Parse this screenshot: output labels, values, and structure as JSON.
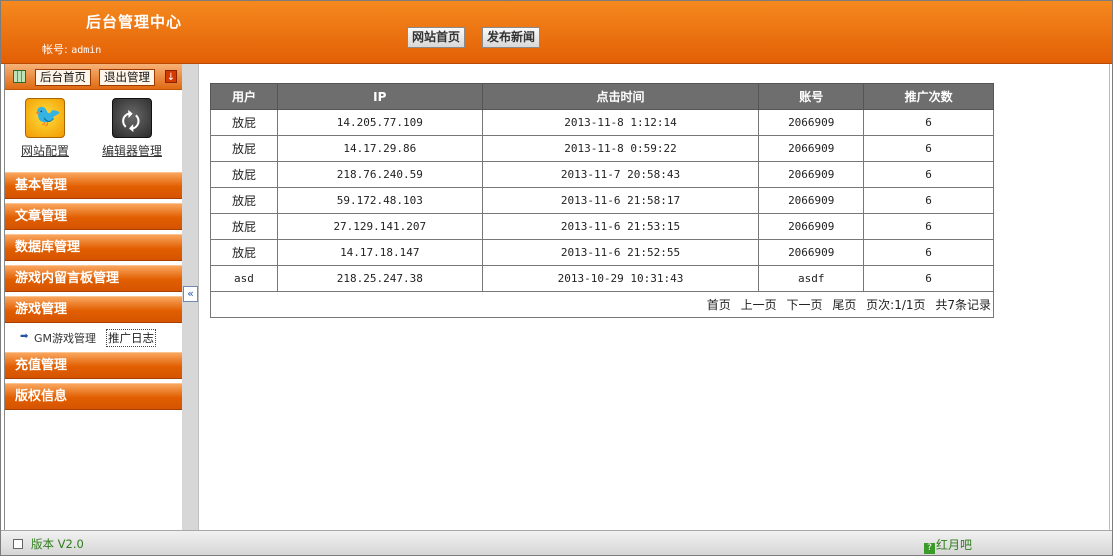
{
  "header": {
    "brand_text": "",
    "title": "后台管理中心",
    "account_label": "帐号:",
    "account_value": "admin",
    "nav_home": "网站首页",
    "nav_news": "发布新闻"
  },
  "sidebar": {
    "top_home": "后台首页",
    "top_exit": "退出管理",
    "shortcut_site_config": "网站配置",
    "shortcut_editor": "编辑器管理",
    "menu": [
      "基本管理",
      "文章管理",
      "数据库管理",
      "游戏内留言板管理",
      "游戏管理",
      "充值管理",
      "版权信息"
    ],
    "submenu": {
      "gm": "GM游戏管理",
      "promo_log": "推广日志"
    },
    "collapse_glyph": "«"
  },
  "table": {
    "headers": [
      "用户",
      "IP",
      "点击时间",
      "账号",
      "推广次数"
    ],
    "rows": [
      [
        "放屁",
        "14.205.77.109",
        "2013-11-8 1:12:14",
        "2066909",
        "6"
      ],
      [
        "放屁",
        "14.17.29.86",
        "2013-11-8 0:59:22",
        "2066909",
        "6"
      ],
      [
        "放屁",
        "218.76.240.59",
        "2013-11-7 20:58:43",
        "2066909",
        "6"
      ],
      [
        "放屁",
        "59.172.48.103",
        "2013-11-6 21:58:17",
        "2066909",
        "6"
      ],
      [
        "放屁",
        "27.129.141.207",
        "2013-11-6 21:53:15",
        "2066909",
        "6"
      ],
      [
        "放屁",
        "14.17.18.147",
        "2013-11-6 21:52:55",
        "2066909",
        "6"
      ],
      [
        "asd",
        "218.25.247.38",
        "2013-10-29 10:31:43",
        "asdf",
        "6"
      ]
    ],
    "pager": {
      "first": "首页",
      "prev": "上一页",
      "next": "下一页",
      "last": "尾页",
      "page_info": "页次:1/1页",
      "total": "共7条记录"
    }
  },
  "footer": {
    "version": "版本 V2.0",
    "help": "红月吧"
  },
  "colors": {
    "accent_orange": "#e35f05",
    "table_header": "#6e6e6e",
    "footer_text": "#2e7d1a"
  }
}
